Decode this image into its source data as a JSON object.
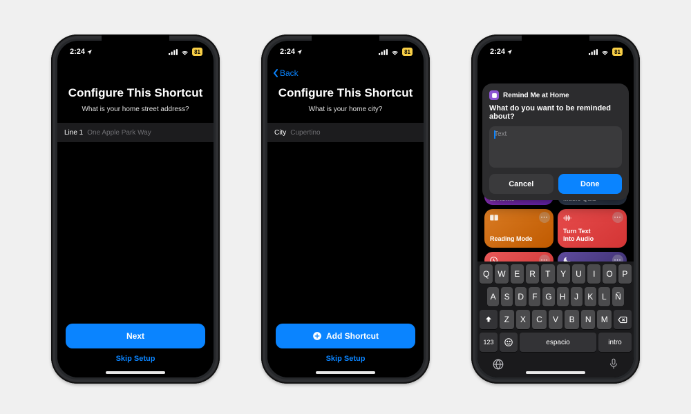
{
  "status": {
    "time": "2:24",
    "battery_pct": "81"
  },
  "phone1": {
    "title": "Configure This Shortcut",
    "subtitle": "What is your home street address?",
    "field_label": "Line 1",
    "field_placeholder": "One Apple Park Way",
    "primary_btn": "Next",
    "skip_label": "Skip Setup"
  },
  "phone2": {
    "back_label": "Back",
    "title": "Configure This Shortcut",
    "subtitle": "What is your home city?",
    "field_label": "City",
    "field_placeholder": "Cupertino",
    "primary_btn": "Add Shortcut",
    "skip_label": "Skip Setup"
  },
  "phone3": {
    "prompt": {
      "app_name": "Remind Me at Home",
      "question": "What do you want to be reminded about?",
      "placeholder": "Text",
      "cancel": "Cancel",
      "done": "Done"
    },
    "tiles": {
      "home": "at Home",
      "quiz": "Music Quiz",
      "reading": "Reading Mode",
      "audio": "Turn Text\nInto Audio"
    },
    "keyboard": {
      "row1": [
        "Q",
        "W",
        "E",
        "R",
        "T",
        "Y",
        "U",
        "I",
        "O",
        "P"
      ],
      "row2": [
        "A",
        "S",
        "D",
        "F",
        "G",
        "H",
        "J",
        "K",
        "L",
        "Ñ"
      ],
      "row3": [
        "Z",
        "X",
        "C",
        "V",
        "B",
        "N",
        "M"
      ],
      "num_key": "123",
      "space_key": "espacio",
      "return_key": "intro"
    }
  }
}
